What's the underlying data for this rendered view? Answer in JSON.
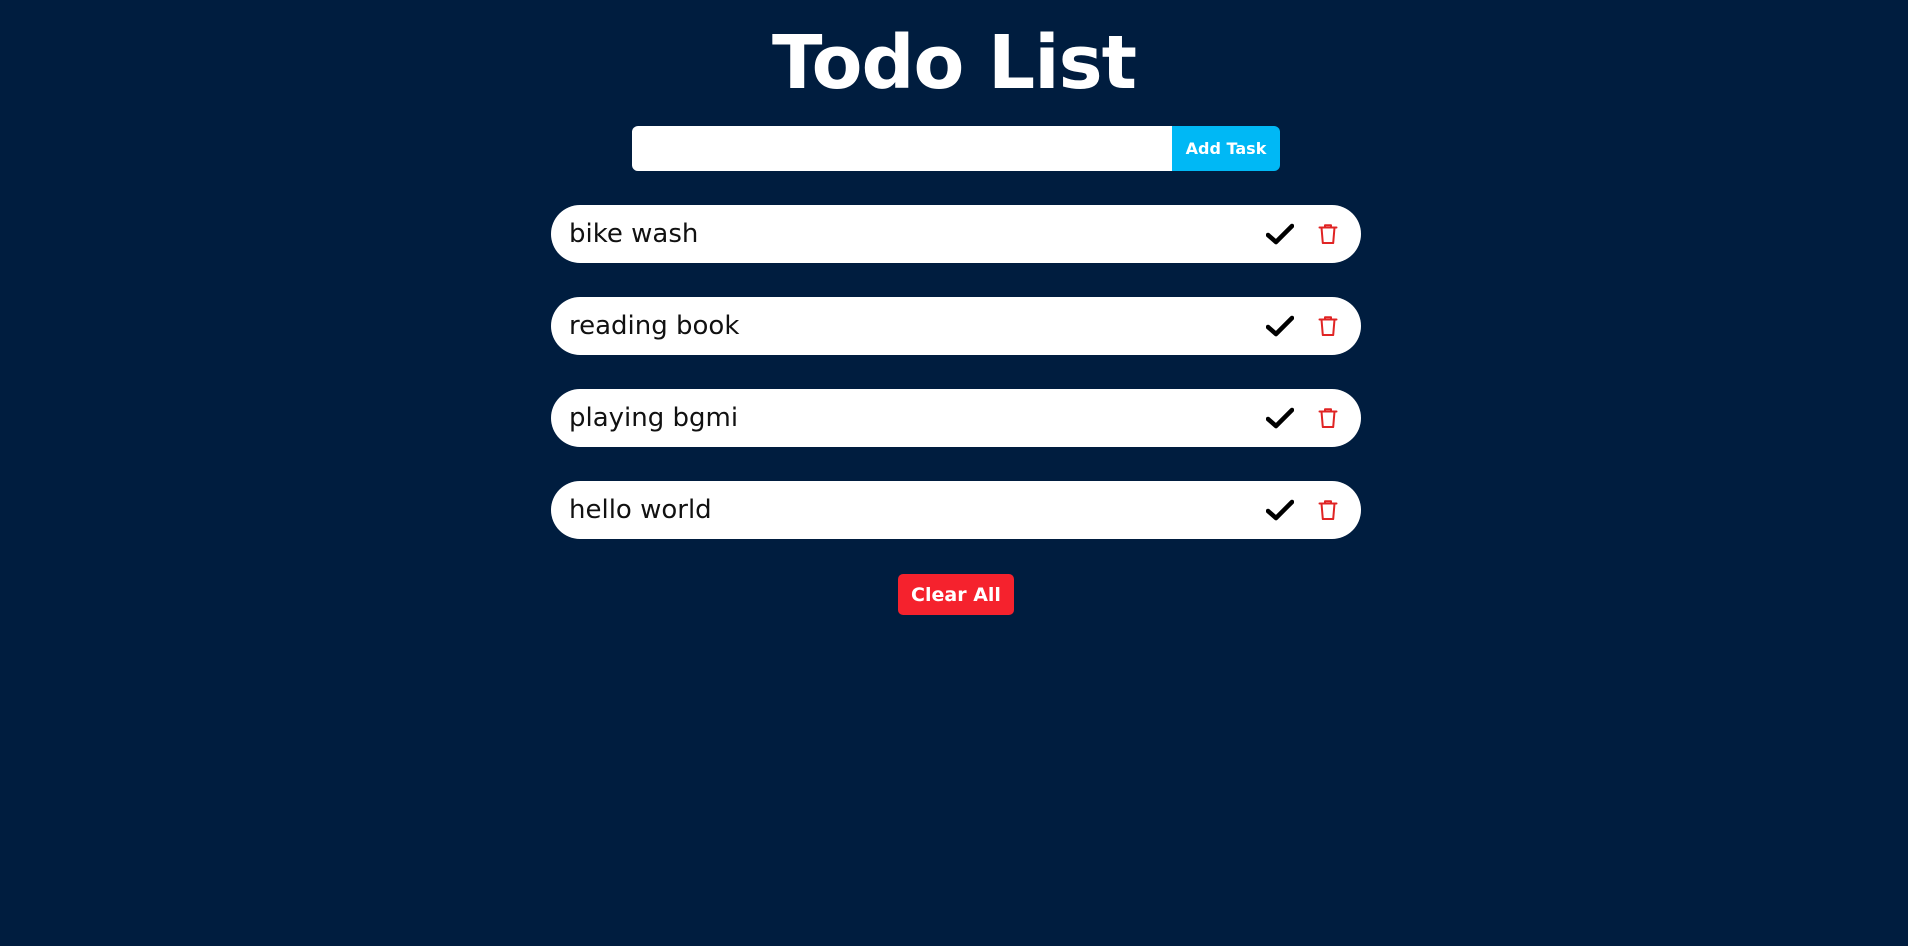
{
  "header": {
    "title": "Todo List"
  },
  "add_form": {
    "input_value": "",
    "input_placeholder": "",
    "button_label": "Add Task"
  },
  "tasks": [
    {
      "label": "bike wash",
      "complete_icon": "check-icon",
      "delete_icon": "trash-icon"
    },
    {
      "label": "reading book",
      "complete_icon": "check-icon",
      "delete_icon": "trash-icon"
    },
    {
      "label": "playing bgmi",
      "complete_icon": "check-icon",
      "delete_icon": "trash-icon"
    },
    {
      "label": "hello world",
      "complete_icon": "check-icon",
      "delete_icon": "trash-icon"
    }
  ],
  "footer": {
    "clear_label": "Clear All"
  },
  "colors": {
    "background": "#001d3f",
    "accent": "#00b8f5",
    "danger": "#f5222d",
    "check": "#000000",
    "trash": "#e02424"
  }
}
